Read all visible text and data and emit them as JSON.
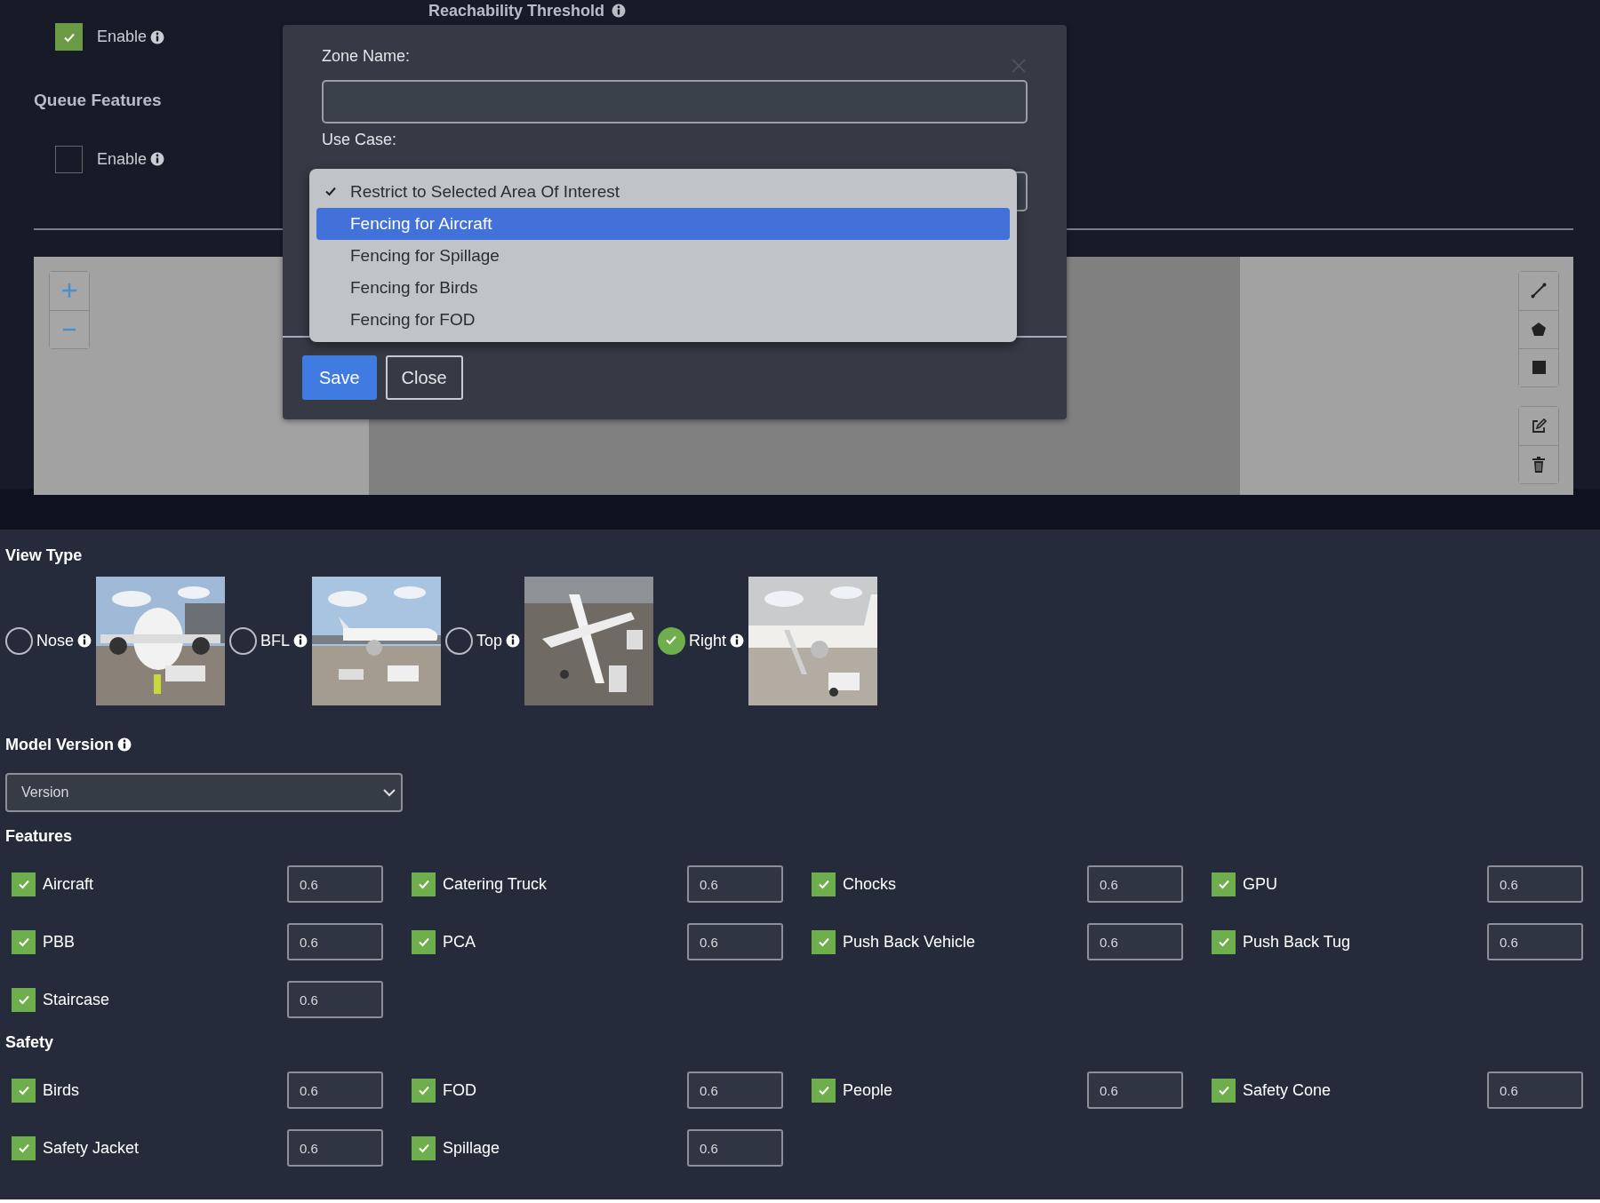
{
  "top_panel": {
    "reachability_label": "Reachability Threshold",
    "enable": {
      "label": "Enable",
      "checked": true
    },
    "queue_features": {
      "heading": "Queue Features",
      "enable": {
        "label": "Enable",
        "checked": false
      }
    }
  },
  "modal": {
    "zone_name_label": "Zone Name:",
    "use_case_label": "Use Case:",
    "use_case_options": [
      {
        "label": "Restrict to Selected Area Of Interest",
        "checked": true,
        "selected": false
      },
      {
        "label": "Fencing for Aircraft",
        "checked": false,
        "selected": true
      },
      {
        "label": "Fencing for Spillage",
        "checked": false,
        "selected": false
      },
      {
        "label": "Fencing for Birds",
        "checked": false,
        "selected": false
      },
      {
        "label": "Fencing for FOD",
        "checked": false,
        "selected": false
      }
    ],
    "buttons": [
      {
        "label": "Save",
        "kind": "primary"
      },
      {
        "label": "Close",
        "kind": "secondary"
      }
    ]
  },
  "view_type": {
    "heading": "View Type",
    "options": [
      {
        "label": "Nose",
        "selected": false,
        "kind": "picture"
      },
      {
        "label": "BFL",
        "selected": false,
        "kind": "picture"
      },
      {
        "label": "Top",
        "selected": false,
        "kind": "picture"
      },
      {
        "label": "Right",
        "selected": true,
        "kind": "picture"
      }
    ]
  },
  "model_version": {
    "label": "Model Version",
    "select_value": "Version"
  },
  "features": {
    "heading": "Features",
    "items": [
      {
        "label": "Aircraft",
        "checked": true,
        "value": "0.6"
      },
      {
        "label": "Catering Truck",
        "checked": true,
        "value": "0.6"
      },
      {
        "label": "Chocks",
        "checked": true,
        "value": "0.6"
      },
      {
        "label": "GPU",
        "checked": true,
        "value": "0.6"
      },
      {
        "label": "PBB",
        "checked": true,
        "value": "0.6"
      },
      {
        "label": "PCA",
        "checked": true,
        "value": "0.6"
      },
      {
        "label": "Push Back Vehicle",
        "checked": true,
        "value": "0.6"
      },
      {
        "label": "Push Back Tug",
        "checked": true,
        "value": "0.6"
      },
      {
        "label": "Staircase",
        "checked": true,
        "value": "0.6"
      }
    ]
  },
  "safety": {
    "heading": "Safety",
    "items": [
      {
        "label": "Birds",
        "checked": true,
        "value": "0.6"
      },
      {
        "label": "FOD",
        "checked": true,
        "value": "0.6"
      },
      {
        "label": "People",
        "checked": true,
        "value": "0.6"
      },
      {
        "label": "Safety Cone",
        "checked": true,
        "value": "0.6"
      },
      {
        "label": "Safety Jacket",
        "checked": true,
        "value": "0.6"
      },
      {
        "label": "Spillage",
        "checked": true,
        "value": "0.6"
      }
    ]
  }
}
